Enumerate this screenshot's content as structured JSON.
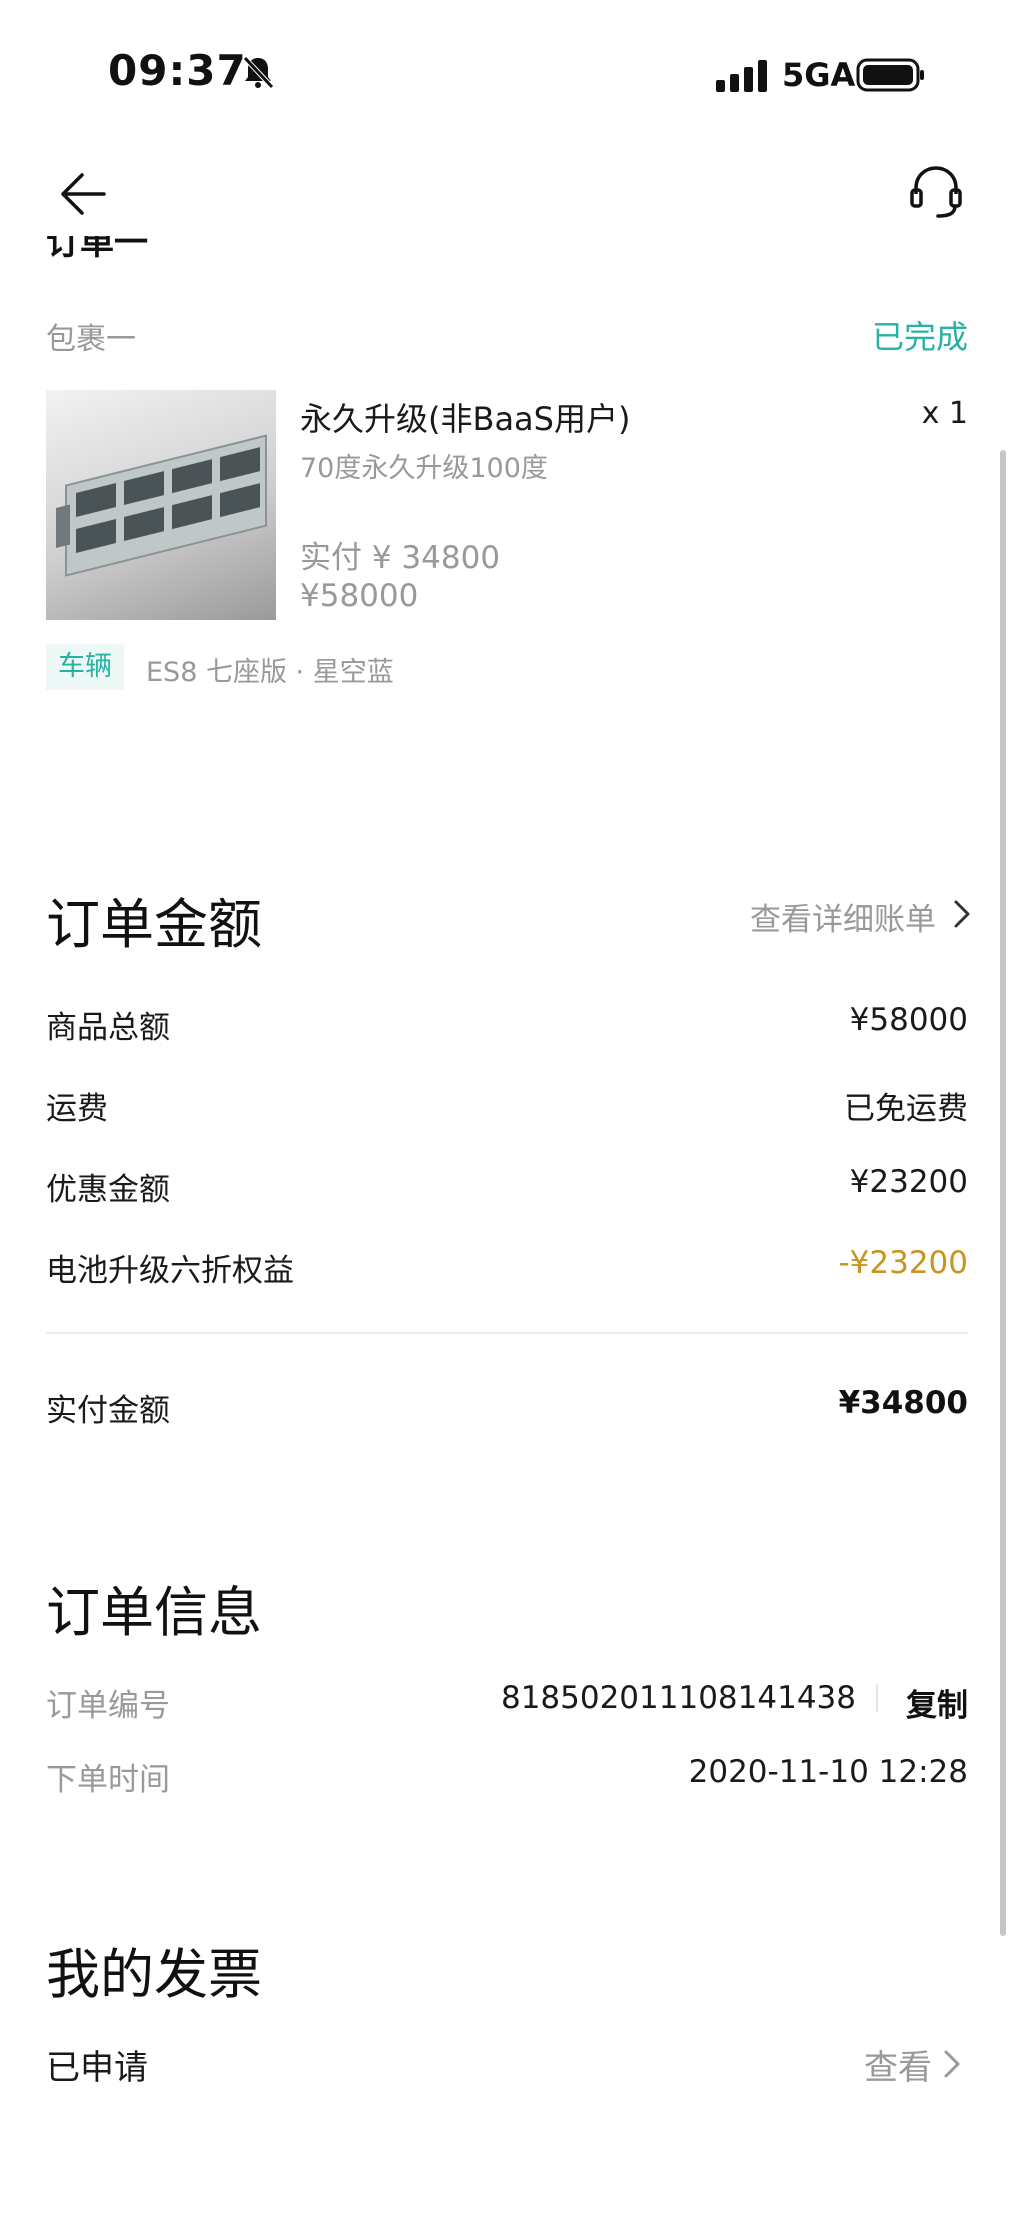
{
  "status_bar": {
    "time": "09:37",
    "network": "5GA"
  },
  "header": {
    "cut_title": "订单一"
  },
  "package": {
    "name": "包裹一",
    "status": "已完成",
    "product": {
      "name": "永久升级(非BaaS用户)",
      "quantity": "x 1",
      "description": "70度永久升级100度",
      "paid": "实付 ¥ 34800",
      "price": "¥58000"
    },
    "vehicle_tag": "车辆",
    "vehicle": "ES8 七座版 · 星空蓝"
  },
  "order_amount": {
    "title": "订单金额",
    "detail_link": "查看详细账单",
    "rows": [
      {
        "label": "商品总额",
        "value": "¥58000"
      },
      {
        "label": "运费",
        "value": "已免运费"
      },
      {
        "label": "优惠金额",
        "value": "¥23200"
      },
      {
        "label": "电池升级六折权益",
        "value": "-¥23200"
      }
    ],
    "total_label": "实付金额",
    "total_value": "¥34800"
  },
  "order_info": {
    "title": "订单信息",
    "number_label": "订单编号",
    "number_value": "818502011108141438",
    "copy_label": "复制",
    "time_label": "下单时间",
    "time_value": "2020-11-10 12:28"
  },
  "invoice": {
    "title": "我的发票",
    "status": "已申请",
    "view_label": "查看"
  },
  "colors": {
    "accent": "#28b2a5",
    "discount": "#c99420",
    "muted": "#999999"
  }
}
